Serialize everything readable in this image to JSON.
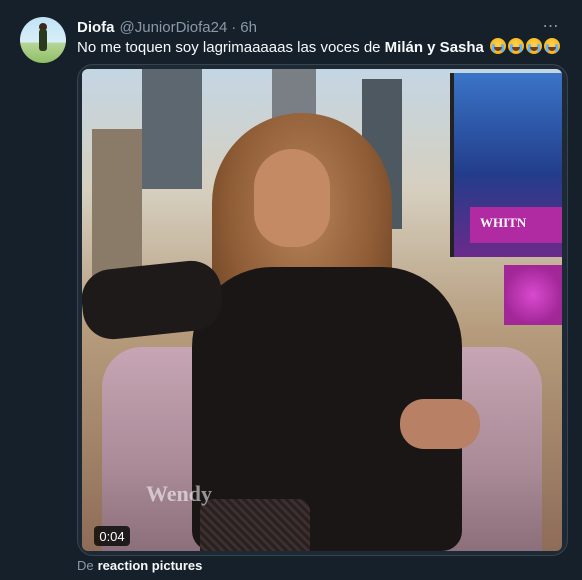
{
  "author": {
    "display_name": "Diofa",
    "handle": "@JuniorDiofa24",
    "separator": "·",
    "time": "6h"
  },
  "more_icon": "⋯",
  "tweet": {
    "text_prefix": "No me toquen soy lagrimaaaaas las voces de ",
    "text_bold": "Milán y Sasha",
    "emojis": [
      "crying-face-icon",
      "crying-face-icon",
      "crying-face-icon",
      "crying-face-icon"
    ]
  },
  "media": {
    "duration": "0:04",
    "banner_text": "WHITN",
    "watermark_text": "Wendy"
  },
  "source": {
    "prefix": "De",
    "link": "reaction pictures"
  },
  "colors": {
    "background": "#15202b",
    "primary_text": "#f7f9f9",
    "secondary_text": "#8b98a5",
    "border": "#38444d"
  }
}
